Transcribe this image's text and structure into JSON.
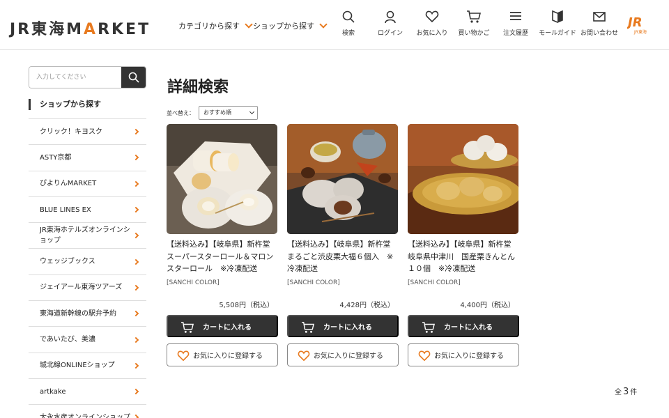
{
  "header": {
    "logo_pre": "JR東海M",
    "logo_a": "A",
    "logo_post": "RKET",
    "nav": [
      {
        "label": "カテゴリから探す"
      },
      {
        "label": "ショップから探す"
      }
    ],
    "icons": [
      {
        "name": "search-icon",
        "label": "検索"
      },
      {
        "name": "user-icon",
        "label": "ログイン"
      },
      {
        "name": "heart-icon",
        "label": "お気に入り"
      },
      {
        "name": "cart-icon",
        "label": "買い物かご"
      },
      {
        "name": "list-icon",
        "label": "注文履歴"
      },
      {
        "name": "book-icon",
        "label": "モールガイド"
      },
      {
        "name": "mail-icon",
        "label": "お問い合わせ"
      }
    ],
    "jr_logo_text": "JR東海",
    "brand_color": "#e87a1f"
  },
  "sidebar": {
    "search_placeholder": "入力してください",
    "heading": "ショップから探す",
    "items": [
      {
        "label": "クリック！キヨスク"
      },
      {
        "label": "ASTY京都"
      },
      {
        "label": "ぴよりんMARKET"
      },
      {
        "label": "BLUE LINES EX"
      },
      {
        "label": "JR東海ホテルズオンラインショップ"
      },
      {
        "label": "ウェッジブックス"
      },
      {
        "label": "ジェイアール東海ツアーズ"
      },
      {
        "label": "東海道新幹線の駅弁予約"
      },
      {
        "label": "であいたび、美濃"
      },
      {
        "label": "城北線ONLINEショップ"
      },
      {
        "label": "artkake"
      },
      {
        "label": "大永水産オンラインショップ"
      }
    ]
  },
  "main": {
    "title": "詳細検索",
    "sort_label": "並べ替え：",
    "sort_value": "おすすめ順",
    "products": [
      {
        "name": "【送料込み】【岐阜県】新杵堂　スーパースターロール＆マロンスターロール　※冷凍配送",
        "shop": "[SANCHI COLOR]",
        "price": "5,508円（税込）",
        "cart_label": "カートに入れる",
        "fav_label": "お気に入りに登録する"
      },
      {
        "name": "【送料込み】【岐阜県】新杵堂　まるごと渋皮栗大福６個入　※冷凍配送",
        "shop": "[SANCHI COLOR]",
        "price": "4,428円（税込）",
        "cart_label": "カートに入れる",
        "fav_label": "お気に入りに登録する"
      },
      {
        "name": "【送料込み】【岐阜県】新杵堂　岐阜県中津川　国産栗きんとん１０個　※冷凍配送",
        "shop": "[SANCHI COLOR]",
        "price": "4,400円（税込）",
        "cart_label": "カートに入れる",
        "fav_label": "お気に入りに登録する"
      }
    ],
    "total_pre": "全",
    "total_count": "3",
    "total_post": "件"
  }
}
